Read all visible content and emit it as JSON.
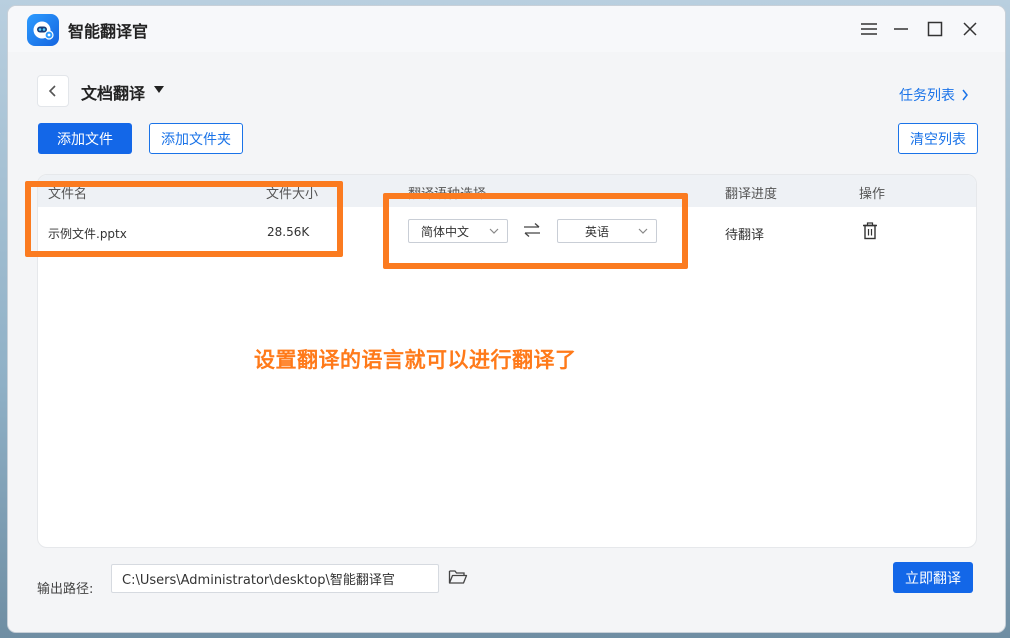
{
  "app": {
    "title": "智能翻译官"
  },
  "header": {
    "page_title": "文档翻译",
    "task_list": "任务列表"
  },
  "toolbar": {
    "add_file": "添加文件",
    "add_folder": "添加文件夹",
    "clear_list": "清空列表"
  },
  "table": {
    "columns": [
      "文件名",
      "文件大小",
      "翻译语种选择",
      "翻译进度",
      "操作"
    ],
    "rows": [
      {
        "file_name": "示例文件.pptx",
        "file_size": "28.56K",
        "source_lang": "简体中文",
        "target_lang": "英语",
        "progress": "待翻译"
      }
    ]
  },
  "annotation": "设置翻译的语言就可以进行翻译了",
  "footer": {
    "output_label": "输出路径:",
    "output_path": "C:\\Users\\Administrator\\desktop\\智能翻译官",
    "translate_button": "立即翻译"
  },
  "icons": {
    "logo": "robot-logo-icon",
    "swap": "swap-arrows-icon",
    "delete": "trash-icon",
    "folder": "folder-open-icon"
  },
  "colors": {
    "accent": "#1367e8",
    "highlight": "#fb7b20"
  }
}
